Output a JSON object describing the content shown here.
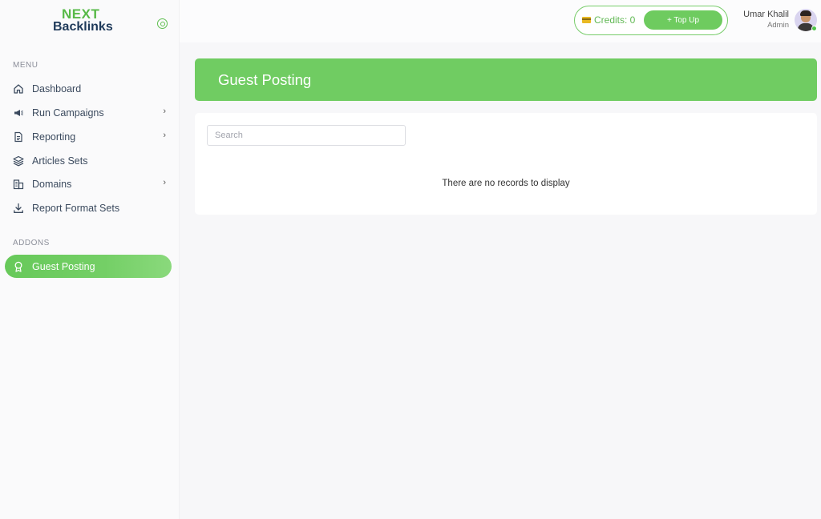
{
  "brand": {
    "logo_top": "NEXT",
    "logo_bottom": "Backlinks"
  },
  "sidebar": {
    "menu_title": "MENU",
    "items": [
      {
        "label": "Dashboard",
        "icon": "home-icon",
        "has_submenu": false
      },
      {
        "label": "Run Campaigns",
        "icon": "megaphone-icon",
        "has_submenu": true
      },
      {
        "label": "Reporting",
        "icon": "document-icon",
        "has_submenu": true
      },
      {
        "label": "Articles Sets",
        "icon": "layers-icon",
        "has_submenu": false
      },
      {
        "label": "Domains",
        "icon": "building-icon",
        "has_submenu": true
      },
      {
        "label": "Report Format Sets",
        "icon": "download-icon",
        "has_submenu": false
      }
    ],
    "addons_title": "ADDONS",
    "addons": [
      {
        "label": "Guest Posting",
        "icon": "award-icon",
        "active": true
      }
    ]
  },
  "topbar": {
    "credits_label": "Credits: 0",
    "topup_label": "+ Top Up",
    "user": {
      "name": "Umar Khalil",
      "role": "Admin"
    }
  },
  "page": {
    "title": "Guest Posting",
    "search_placeholder": "Search",
    "empty_message": "There are no records to display"
  },
  "colors": {
    "accent": "#70cc62",
    "accent_dark": "#57b947",
    "brand_navy": "#1f3a5a"
  }
}
